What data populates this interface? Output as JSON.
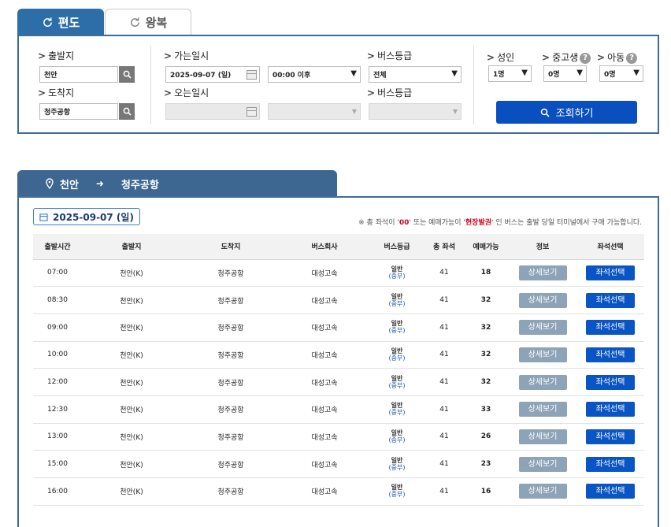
{
  "tabs": {
    "oneway": "편도",
    "roundtrip": "왕복"
  },
  "search": {
    "depart_label": "출발지",
    "depart_value": "천안",
    "arrive_label": "도착지",
    "arrive_value": "청주공항",
    "go_date_label": "가는일시",
    "go_date_value": "2025-09-07 (일)",
    "go_time_value": "00:00 이후",
    "bus_grade_label": "버스등급",
    "bus_grade_value": "전체",
    "return_date_label": "오는일시",
    "return_grade_label": "버스등급",
    "adult_label": "성인",
    "adult_value": "1명",
    "youth_label": "중고생",
    "youth_value": "0명",
    "child_label": "아동",
    "child_value": "0명",
    "help_mark": "?",
    "search_button": "조회하기"
  },
  "route": {
    "from": "천안",
    "to": "청주공항"
  },
  "result": {
    "date": "2025-09-07 (일)",
    "notice_pre": "※ 총 좌석이 '",
    "notice_00": "00",
    "notice_mid": "' 또는 예매가능이 '",
    "notice_onsite": "현장발권",
    "notice_post": "' 인 버스는 출발 당일 터미널에서 구매 가능합니다.",
    "headers": [
      "출발시간",
      "출발지",
      "도착지",
      "버스회사",
      "버스등급",
      "총 좌석",
      "예매가능",
      "정보",
      "좌석선택"
    ],
    "detail_button": "상세보기",
    "seat_button": "좌석선택",
    "rows": [
      {
        "time": "07:00",
        "from": "천안(K)",
        "to": "청주공항",
        "company": "대성고속",
        "grade_top": "일반",
        "grade_bottom": "(중부)",
        "total": "41",
        "remain": "18"
      },
      {
        "time": "08:30",
        "from": "천안(K)",
        "to": "청주공항",
        "company": "대성고속",
        "grade_top": "일반",
        "grade_bottom": "(중부)",
        "total": "41",
        "remain": "32"
      },
      {
        "time": "09:00",
        "from": "천안(K)",
        "to": "청주공항",
        "company": "대성고속",
        "grade_top": "일반",
        "grade_bottom": "(중부)",
        "total": "41",
        "remain": "32"
      },
      {
        "time": "10:00",
        "from": "천안(K)",
        "to": "청주공항",
        "company": "대성고속",
        "grade_top": "일반",
        "grade_bottom": "(중부)",
        "total": "41",
        "remain": "32"
      },
      {
        "time": "12:00",
        "from": "천안(K)",
        "to": "청주공항",
        "company": "대성고속",
        "grade_top": "일반",
        "grade_bottom": "(중부)",
        "total": "41",
        "remain": "32"
      },
      {
        "time": "12:30",
        "from": "천안(K)",
        "to": "청주공항",
        "company": "대성고속",
        "grade_top": "일반",
        "grade_bottom": "(중부)",
        "total": "41",
        "remain": "33"
      },
      {
        "time": "13:00",
        "from": "천안(K)",
        "to": "청주공항",
        "company": "대성고속",
        "grade_top": "일반",
        "grade_bottom": "(중부)",
        "total": "41",
        "remain": "26"
      },
      {
        "time": "15:00",
        "from": "천안(K)",
        "to": "청주공항",
        "company": "대성고속",
        "grade_top": "일반",
        "grade_bottom": "(중부)",
        "total": "41",
        "remain": "23"
      },
      {
        "time": "16:00",
        "from": "천안(K)",
        "to": "청주공항",
        "company": "대성고속",
        "grade_top": "일반",
        "grade_bottom": "(중부)",
        "total": "41",
        "remain": "16"
      }
    ]
  },
  "colors": {
    "primary": "#2d6ea8",
    "route_bar": "#3d6791",
    "search_button": "#0a4fc0",
    "detail_button": "#8da3b8",
    "seat_button": "#0a55c5",
    "notice_red": "#d0021b"
  },
  "icons": {
    "tab": "refresh-icon",
    "search": "magnifier-icon",
    "route": "map-pin-icon",
    "date": "calendar-icon",
    "help": "question-icon"
  }
}
